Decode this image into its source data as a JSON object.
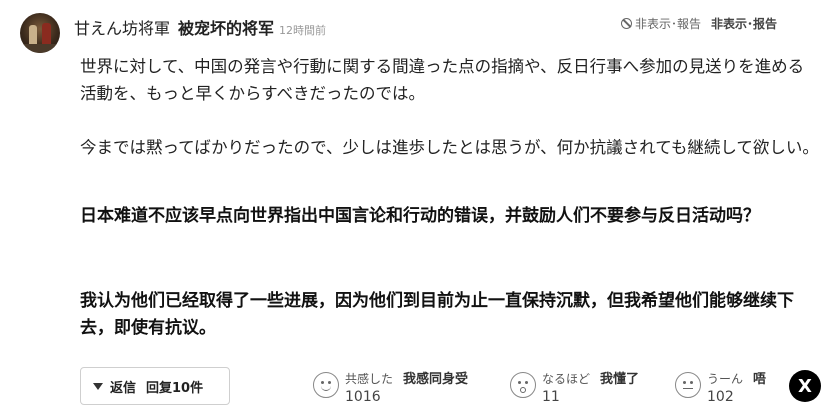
{
  "comment": {
    "username": "甘えん坊将軍",
    "username_translation": "被宠坏的将军",
    "time": "12時間前",
    "report_label": "非表示･報告",
    "report_translation": "非表示･报告",
    "paragraph1": "世界に対して、中国の発言や行動に関する間違った点の指摘や、反日行事へ参加の見送りを進める活動を、もっと早くからすべきだったのでは。",
    "paragraph2": "今までは黙ってばかりだったので、少しは進歩したとは思うが、何か抗議されても継続して欲しい。",
    "translation1": "日本难道不应该早点向世界指出中国言论和行动的错误，并鼓励人们不要参与反日活动吗？",
    "translation2": "我认为他们已经取得了一些进展，因为他们到目前为止一直保持沉默，但我希望他们能够继续下去，即使有抗议。"
  },
  "footer": {
    "reply_label": "返信",
    "reply_translation": "回复10件",
    "reactions": [
      {
        "icon": "smile-icon",
        "label": "共感した",
        "translation": "我感同身受",
        "count": "1016"
      },
      {
        "icon": "surprised-icon",
        "label": "なるほど",
        "translation": "我懂了",
        "count": "11"
      },
      {
        "icon": "thinking-icon",
        "label": "うーん",
        "translation": "唔",
        "count": "102"
      }
    ],
    "x_label": "X"
  }
}
